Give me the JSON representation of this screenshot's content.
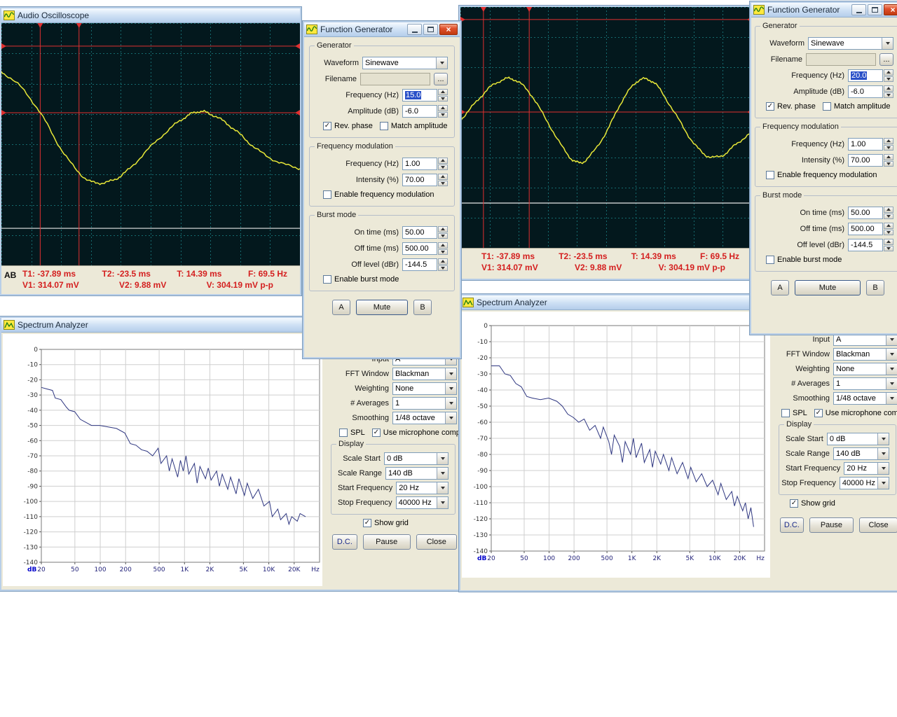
{
  "osc1": {
    "title": "Audio Oscilloscope",
    "channels_label": "AB",
    "meas": {
      "t1": "T1: -37.89 ms",
      "t2": "T2: -23.5 ms",
      "t": "T: 14.39 ms",
      "f": "F: 69.5 Hz",
      "v1": "V1: 314.07 mV",
      "v2": "V2: 9.88 mV",
      "v": "V: 304.19 mV p-p"
    },
    "scope": {
      "grid_cols": 10,
      "grid_rows": 8,
      "bg_color": "#03181d",
      "grid_color": "#156a6e",
      "wave_color": "#e8e838",
      "cursor_color": "#e03030",
      "ref_color": "#e8e8e8",
      "v_cursors": [
        0.13,
        0.26
      ],
      "h_cursors": [
        0.095,
        0.37
      ],
      "ref_line": 0.847,
      "wave": [
        [
          0,
          0.2
        ],
        [
          0.07,
          0.27
        ],
        [
          0.14,
          0.39
        ],
        [
          0.21,
          0.54
        ],
        [
          0.28,
          0.64
        ],
        [
          0.33,
          0.66
        ],
        [
          0.38,
          0.645
        ],
        [
          0.43,
          0.6
        ],
        [
          0.5,
          0.51
        ],
        [
          0.57,
          0.43
        ],
        [
          0.62,
          0.385
        ],
        [
          0.66,
          0.365
        ],
        [
          0.7,
          0.375
        ],
        [
          0.75,
          0.41
        ],
        [
          0.8,
          0.46
        ],
        [
          0.86,
          0.525
        ],
        [
          0.93,
          0.575
        ],
        [
          1.0,
          0.6
        ]
      ]
    }
  },
  "osc2": {
    "meas": {
      "t1": "T1: -37.89 ms",
      "t2": "T2: -23.5 ms",
      "t": "T: 14.39 ms",
      "f": "F: 69.5 Hz",
      "v1": "V1: 314.07 mV",
      "v2": "V2: 9.88 mV",
      "v": "V: 304.19 mV p-p"
    },
    "scope": {
      "grid_cols": 10,
      "grid_rows": 8,
      "bg_color": "#03181d",
      "grid_color": "#156a6e",
      "wave_color": "#e8e838",
      "cursor_color": "#e03030",
      "ref_color": "#e8e8e8",
      "v_cursors": [
        0.079,
        0.236
      ],
      "h_cursors": [
        0.052,
        0.436
      ],
      "ref_line": 0.814,
      "wave": [
        [
          0,
          0.47
        ],
        [
          0.05,
          0.4
        ],
        [
          0.1,
          0.335
        ],
        [
          0.15,
          0.3
        ],
        [
          0.19,
          0.305
        ],
        [
          0.24,
          0.36
        ],
        [
          0.3,
          0.48
        ],
        [
          0.36,
          0.6
        ],
        [
          0.4,
          0.645
        ],
        [
          0.44,
          0.625
        ],
        [
          0.5,
          0.52
        ],
        [
          0.55,
          0.4
        ],
        [
          0.6,
          0.315
        ],
        [
          0.64,
          0.3
        ],
        [
          0.68,
          0.335
        ],
        [
          0.74,
          0.45
        ],
        [
          0.8,
          0.565
        ],
        [
          0.85,
          0.62
        ],
        [
          0.9,
          0.615
        ],
        [
          0.95,
          0.565
        ],
        [
          1.0,
          0.52
        ]
      ]
    }
  },
  "fg1": {
    "title": "Function Generator",
    "generator_group": "Generator",
    "waveform_label": "Waveform",
    "waveform_value": "Sinewave",
    "filename_label": "Filename",
    "browse_label": "...",
    "frequency_label": "Frequency (Hz)",
    "frequency_value": "15.0",
    "amplitude_label": "Amplitude (dB)",
    "amplitude_value": "-6.0",
    "rev_phase_label": "Rev. phase",
    "match_amplitude_label": "Match amplitude",
    "fm_group": "Frequency modulation",
    "fm_frequency_label": "Frequency (Hz)",
    "fm_frequency_value": "1.00",
    "fm_intensity_label": "Intensity (%)",
    "fm_intensity_value": "70.00",
    "fm_enable_label": "Enable frequency modulation",
    "burst_group": "Burst mode",
    "on_time_label": "On time (ms)",
    "on_time_value": "50.00",
    "off_time_label": "Off time (ms)",
    "off_time_value": "500.00",
    "off_level_label": "Off level (dBr)",
    "off_level_value": "-144.5",
    "burst_enable_label": "Enable burst mode",
    "button_a": "A",
    "button_mute": "Mute",
    "button_b": "B"
  },
  "fg2": {
    "title": "Function Generator",
    "generator_group": "Generator",
    "waveform_label": "Waveform",
    "waveform_value": "Sinewave",
    "filename_label": "Filename",
    "browse_label": "...",
    "frequency_label": "Frequency (Hz)",
    "frequency_value": "20.0",
    "amplitude_label": "Amplitude (dB)",
    "amplitude_value": "-6.0",
    "rev_phase_label": "Rev. phase",
    "match_amplitude_label": "Match amplitude",
    "fm_group": "Frequency modulation",
    "fm_frequency_label": "Frequency (Hz)",
    "fm_frequency_value": "1.00",
    "fm_intensity_label": "Intensity (%)",
    "fm_intensity_value": "70.00",
    "fm_enable_label": "Enable frequency modulation",
    "burst_group": "Burst mode",
    "on_time_label": "On time (ms)",
    "on_time_value": "50.00",
    "off_time_label": "Off time (ms)",
    "off_time_value": "500.00",
    "off_level_label": "Off level (dBr)",
    "off_level_value": "-144.5",
    "burst_enable_label": "Enable burst mode",
    "button_a": "A",
    "button_mute": "Mute",
    "button_b": "B"
  },
  "sa1": {
    "title": "Spectrum Analyzer",
    "controls": {
      "input_label": "Input",
      "input_value": "A",
      "fft_window_label": "FFT Window",
      "fft_window_value": "Blackman",
      "weighting_label": "Weighting",
      "weighting_value": "None",
      "averages_label": "# Averages",
      "averages_value": "1",
      "smoothing_label": "Smoothing",
      "smoothing_value": "1/48 octave",
      "spl_label": "SPL",
      "mic_comp_label": "Use microphone comp.",
      "display_group": "Display",
      "scale_start_label": "Scale Start",
      "scale_start_value": "0 dB",
      "scale_range_label": "Scale Range",
      "scale_range_value": "140 dB",
      "start_freq_label": "Start Frequency",
      "start_freq_value": "20 Hz",
      "stop_freq_label": "Stop Frequency",
      "stop_freq_value": "40000 Hz",
      "show_grid_label": "Show grid",
      "dc_button": "D.C.",
      "pause_button": "Pause",
      "close_button": "Close"
    },
    "chart": {
      "type": "line",
      "unit_y": "dB",
      "unit_x": "Hz",
      "ylim": [
        0,
        -140
      ],
      "y_step": 10,
      "x_ticks": [
        [
          "20",
          0
        ],
        [
          "50",
          0.1205
        ],
        [
          "100",
          0.2117
        ],
        [
          "200",
          0.3029
        ],
        [
          "500",
          0.4234
        ],
        [
          "1K",
          0.5146
        ],
        [
          "2K",
          0.6058
        ],
        [
          "5K",
          0.7264
        ],
        [
          "10K",
          0.8176
        ],
        [
          "20K",
          0.9088
        ]
      ],
      "trace_color": "#2e3680",
      "points": [
        [
          0.0,
          -25
        ],
        [
          0.02,
          -26
        ],
        [
          0.04,
          -27
        ],
        [
          0.05,
          -32
        ],
        [
          0.07,
          -33
        ],
        [
          0.09,
          -38
        ],
        [
          0.1,
          -40
        ],
        [
          0.12,
          -41
        ],
        [
          0.14,
          -46
        ],
        [
          0.16,
          -48
        ],
        [
          0.18,
          -50
        ],
        [
          0.21,
          -50
        ],
        [
          0.24,
          -51
        ],
        [
          0.27,
          -52
        ],
        [
          0.3,
          -55
        ],
        [
          0.32,
          -62
        ],
        [
          0.34,
          -63
        ],
        [
          0.36,
          -66
        ],
        [
          0.38,
          -67
        ],
        [
          0.4,
          -70
        ],
        [
          0.42,
          -65
        ],
        [
          0.43,
          -75
        ],
        [
          0.45,
          -70
        ],
        [
          0.46,
          -80
        ],
        [
          0.47,
          -72
        ],
        [
          0.49,
          -84
        ],
        [
          0.5,
          -73
        ],
        [
          0.51,
          -80
        ],
        [
          0.52,
          -70
        ],
        [
          0.53,
          -82
        ],
        [
          0.55,
          -75
        ],
        [
          0.56,
          -88
        ],
        [
          0.57,
          -77
        ],
        [
          0.59,
          -85
        ],
        [
          0.6,
          -78
        ],
        [
          0.61,
          -86
        ],
        [
          0.63,
          -80
        ],
        [
          0.64,
          -90
        ],
        [
          0.65,
          -82
        ],
        [
          0.67,
          -92
        ],
        [
          0.68,
          -84
        ],
        [
          0.7,
          -95
        ],
        [
          0.71,
          -85
        ],
        [
          0.73,
          -96
        ],
        [
          0.74,
          -88
        ],
        [
          0.76,
          -98
        ],
        [
          0.78,
          -92
        ],
        [
          0.8,
          -103
        ],
        [
          0.82,
          -100
        ],
        [
          0.83,
          -110
        ],
        [
          0.85,
          -105
        ],
        [
          0.86,
          -112
        ],
        [
          0.88,
          -108
        ],
        [
          0.89,
          -115
        ],
        [
          0.9,
          -110
        ],
        [
          0.92,
          -113
        ],
        [
          0.93,
          -108
        ],
        [
          0.95,
          -110
        ]
      ]
    }
  },
  "sa2": {
    "title": "Spectrum Analyzer",
    "controls": {
      "input_label": "Input",
      "input_value": "A",
      "fft_window_label": "FFT Window",
      "fft_window_value": "Blackman",
      "weighting_label": "Weighting",
      "weighting_value": "None",
      "averages_label": "# Averages",
      "averages_value": "1",
      "smoothing_label": "Smoothing",
      "smoothing_value": "1/48 octave",
      "spl_label": "SPL",
      "mic_comp_label": "Use microphone comp.",
      "display_group": "Display",
      "scale_start_label": "Scale Start",
      "scale_start_value": "0 dB",
      "scale_range_label": "Scale Range",
      "scale_range_value": "140 dB",
      "start_freq_label": "Start Frequency",
      "start_freq_value": "20 Hz",
      "stop_freq_label": "Stop Frequency",
      "stop_freq_value": "40000 Hz",
      "show_grid_label": "Show grid",
      "dc_button": "D.C.",
      "pause_button": "Pause",
      "close_button": "Close"
    },
    "chart": {
      "type": "line",
      "unit_y": "dB",
      "unit_x": "Hz",
      "ylim": [
        0,
        -140
      ],
      "y_step": 10,
      "x_ticks": [
        [
          "20",
          0
        ],
        [
          "50",
          0.1205
        ],
        [
          "100",
          0.2117
        ],
        [
          "200",
          0.3029
        ],
        [
          "500",
          0.4234
        ],
        [
          "1K",
          0.5146
        ],
        [
          "2K",
          0.6058
        ],
        [
          "5K",
          0.7264
        ],
        [
          "10K",
          0.8176
        ],
        [
          "20K",
          0.9088
        ]
      ],
      "trace_color": "#2e3680",
      "points": [
        [
          0.0,
          -25
        ],
        [
          0.03,
          -25
        ],
        [
          0.05,
          -30
        ],
        [
          0.07,
          -31
        ],
        [
          0.09,
          -36
        ],
        [
          0.11,
          -38
        ],
        [
          0.13,
          -44
        ],
        [
          0.15,
          -45
        ],
        [
          0.18,
          -46
        ],
        [
          0.21,
          -45
        ],
        [
          0.24,
          -47
        ],
        [
          0.26,
          -50
        ],
        [
          0.28,
          -55
        ],
        [
          0.3,
          -57
        ],
        [
          0.32,
          -60
        ],
        [
          0.34,
          -58
        ],
        [
          0.36,
          -65
        ],
        [
          0.38,
          -62
        ],
        [
          0.4,
          -70
        ],
        [
          0.41,
          -63
        ],
        [
          0.43,
          -72
        ],
        [
          0.44,
          -80
        ],
        [
          0.45,
          -68
        ],
        [
          0.47,
          -75
        ],
        [
          0.48,
          -85
        ],
        [
          0.49,
          -72
        ],
        [
          0.51,
          -80
        ],
        [
          0.52,
          -70
        ],
        [
          0.53,
          -82
        ],
        [
          0.55,
          -73
        ],
        [
          0.56,
          -85
        ],
        [
          0.58,
          -77
        ],
        [
          0.59,
          -88
        ],
        [
          0.6,
          -78
        ],
        [
          0.62,
          -86
        ],
        [
          0.63,
          -80
        ],
        [
          0.65,
          -90
        ],
        [
          0.66,
          -82
        ],
        [
          0.68,
          -92
        ],
        [
          0.7,
          -85
        ],
        [
          0.72,
          -95
        ],
        [
          0.73,
          -88
        ],
        [
          0.75,
          -97
        ],
        [
          0.77,
          -92
        ],
        [
          0.79,
          -100
        ],
        [
          0.81,
          -96
        ],
        [
          0.83,
          -105
        ],
        [
          0.84,
          -98
        ],
        [
          0.86,
          -108
        ],
        [
          0.88,
          -103
        ],
        [
          0.89,
          -112
        ],
        [
          0.9,
          -106
        ],
        [
          0.92,
          -115
        ],
        [
          0.93,
          -110
        ],
        [
          0.94,
          -120
        ],
        [
          0.95,
          -113
        ],
        [
          0.96,
          -125
        ]
      ]
    }
  }
}
